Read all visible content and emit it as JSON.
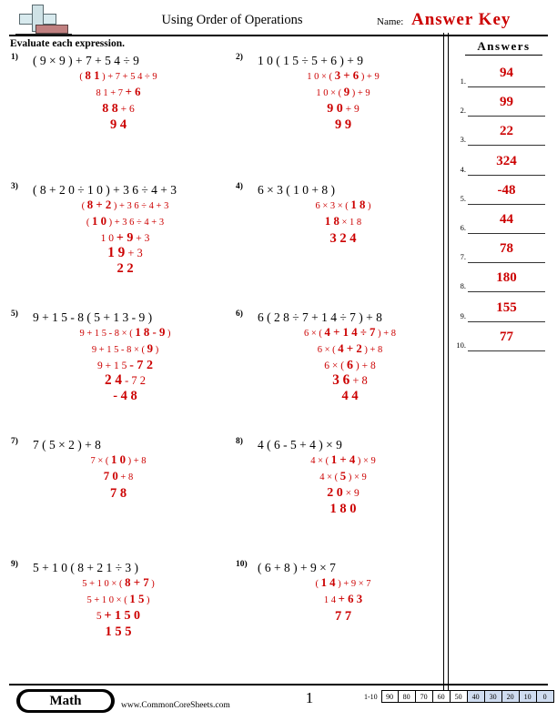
{
  "header": {
    "logo_name": "math-plus-logo",
    "title": "Using Order of Operations",
    "name_label": "Name:",
    "answer_key": "Answer Key",
    "instruction": "Evaluate each expression."
  },
  "answers_panel": {
    "heading": "Answers",
    "rows": [
      {
        "num": "1.",
        "value": "94"
      },
      {
        "num": "2.",
        "value": "99"
      },
      {
        "num": "3.",
        "value": "22"
      },
      {
        "num": "4.",
        "value": "324"
      },
      {
        "num": "5.",
        "value": "-48"
      },
      {
        "num": "6.",
        "value": "44"
      },
      {
        "num": "7.",
        "value": "78"
      },
      {
        "num": "8.",
        "value": "180"
      },
      {
        "num": "9.",
        "value": "155"
      },
      {
        "num": "10.",
        "value": "77"
      }
    ]
  },
  "problems": [
    {
      "num": "1)",
      "expression": "( 9 × 9 ) + 7 + 5 4 ÷ 9",
      "steps": [
        "( <b>8 1</b> ) + 7 + 5 4 ÷ 9",
        "8 1 + 7 <b>+ 6</b>",
        "<b>8 8</b> + 6"
      ],
      "answer": "9 4"
    },
    {
      "num": "2)",
      "expression": "1 0 ( 1 5 ÷ 5 + 6 ) + 9",
      "steps": [
        "1 0 × ( <b>3 + 6</b> ) + 9",
        "1 0 × ( <b>9</b> ) + 9",
        "<b>9 0</b> + 9"
      ],
      "answer": "9 9"
    },
    {
      "num": "3)",
      "expression": "( 8 + 2 0 ÷ 1 0 ) + 3 6 ÷ 4 + 3",
      "steps": [
        "( <b>8 + 2</b> ) + 3 6 ÷ 4 + 3",
        "( <b>1 0</b> ) + 3 6 ÷ 4 + 3",
        "1 0 <b>+ 9</b> + 3",
        "<b>1 9</b> + 3"
      ],
      "answer": "2 2"
    },
    {
      "num": "4)",
      "expression": "6 × 3 ( 1 0 + 8 )",
      "steps": [
        "6 × 3 × ( <b>1 8</b> )",
        "<b>1 8</b> × 1 8"
      ],
      "answer": "3 2 4"
    },
    {
      "num": "5)",
      "expression": "9 + 1 5 - 8 ( 5 + 1 3 - 9 )",
      "steps": [
        "9 + 1 5 - 8 × ( <b>1 8 - 9</b> )",
        "9 + 1 5 - 8 × ( <b>9</b> )",
        "9 + 1 5 <b>- 7 2</b>",
        "<b>2 4</b> - 7 2"
      ],
      "answer": "- 4 8"
    },
    {
      "num": "6)",
      "expression": "6 ( 2 8 ÷ 7 + 1 4 ÷ 7 ) + 8",
      "steps": [
        "6 × ( <b>4 + 1 4 ÷ 7</b> ) + 8",
        "6 × ( <b>4 + 2</b> ) + 8",
        "6 × ( <b>6</b> ) + 8",
        "<b>3 6</b> + 8"
      ],
      "answer": "4 4"
    },
    {
      "num": "7)",
      "expression": "7 ( 5 × 2 ) + 8",
      "steps": [
        "7 × ( <b>1 0</b> ) + 8",
        "<b>7 0</b> + 8"
      ],
      "answer": "7 8"
    },
    {
      "num": "8)",
      "expression": "4 ( 6 - 5 + 4 ) × 9",
      "steps": [
        "4 × ( <b>1 + 4</b> ) × 9",
        "4 × ( <b>5</b> ) × 9",
        "<b>2 0</b> × 9"
      ],
      "answer": "1 8 0"
    },
    {
      "num": "9)",
      "expression": "5 + 1 0 ( 8 + 2 1 ÷ 3 )",
      "steps": [
        "5 + 1 0 × ( <b>8 + 7</b> )",
        "5 + 1 0 × ( <b>1 5</b> )",
        "5 <b>+ 1 5 0</b>"
      ],
      "answer": "1 5 5"
    },
    {
      "num": "10)",
      "expression": "( 6 + 8 ) + 9 × 7",
      "steps": [
        "( <b>1 4</b> ) + 9 × 7",
        "1 4 <b>+ 6 3</b>"
      ],
      "answer": "7 7"
    }
  ],
  "footer": {
    "subject_badge": "Math",
    "site_url": "www.CommonCoreSheets.com",
    "page_number": "1",
    "score_range_label": "1-10",
    "score_boxes": [
      {
        "label": "90",
        "highlighted": false
      },
      {
        "label": "80",
        "highlighted": false
      },
      {
        "label": "70",
        "highlighted": false
      },
      {
        "label": "60",
        "highlighted": false
      },
      {
        "label": "50",
        "highlighted": false
      },
      {
        "label": "40",
        "highlighted": true
      },
      {
        "label": "30",
        "highlighted": true
      },
      {
        "label": "20",
        "highlighted": true
      },
      {
        "label": "10",
        "highlighted": true
      },
      {
        "label": "0",
        "highlighted": true
      }
    ]
  },
  "colors": {
    "answer_red": "#cc0000",
    "score_highlight": "#cfdcf0"
  }
}
